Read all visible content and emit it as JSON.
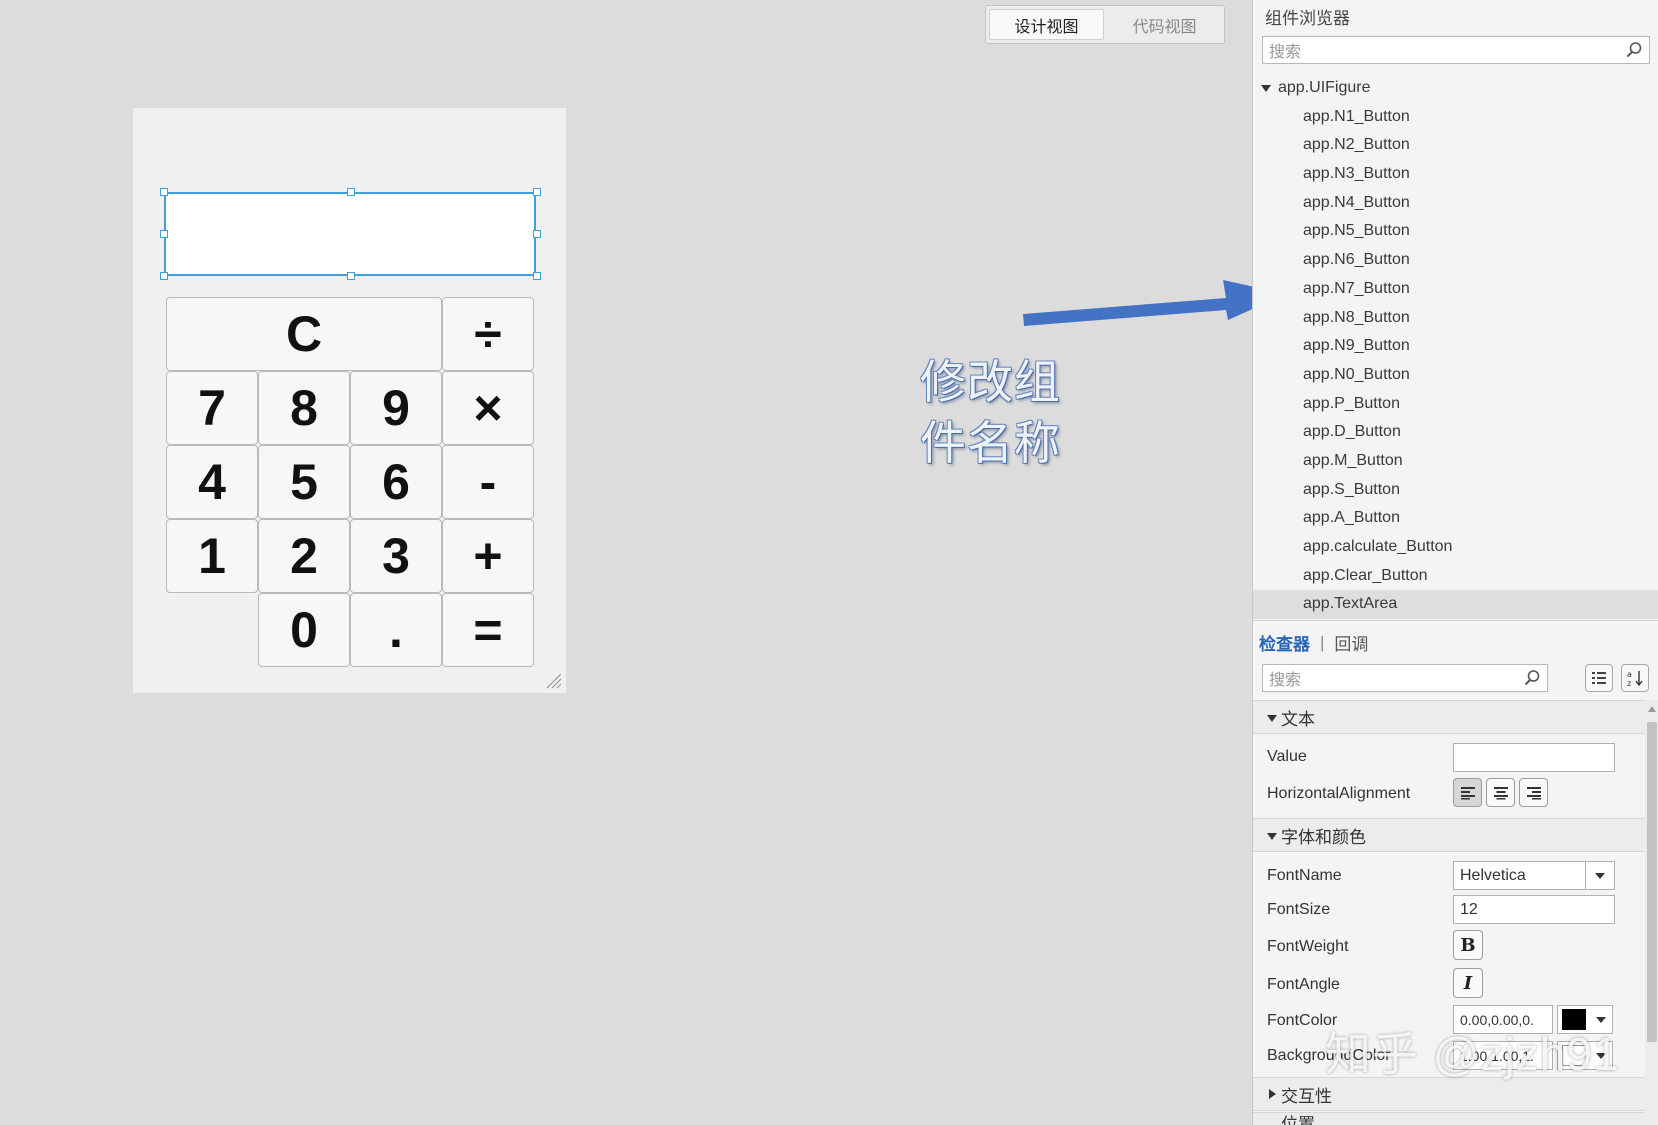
{
  "view_toggle": {
    "design": "设计视图",
    "code": "代码视图"
  },
  "calculator": {
    "buttons": [
      {
        "key": "clear",
        "label": "C"
      },
      {
        "key": "divide",
        "label": "÷"
      },
      {
        "key": "7",
        "label": "7"
      },
      {
        "key": "8",
        "label": "8"
      },
      {
        "key": "9",
        "label": "9"
      },
      {
        "key": "multiply",
        "label": "×"
      },
      {
        "key": "4",
        "label": "4"
      },
      {
        "key": "5",
        "label": "5"
      },
      {
        "key": "6",
        "label": "6"
      },
      {
        "key": "minus",
        "label": "-"
      },
      {
        "key": "1",
        "label": "1"
      },
      {
        "key": "2",
        "label": "2"
      },
      {
        "key": "3",
        "label": "3"
      },
      {
        "key": "plus",
        "label": "+"
      },
      {
        "key": "0",
        "label": "0"
      },
      {
        "key": "point",
        "label": "."
      },
      {
        "key": "equals",
        "label": "="
      }
    ]
  },
  "annotation": {
    "line1": "修改组",
    "line2": "件名称",
    "arrow_color": "#4472c4"
  },
  "component_browser": {
    "title": "组件浏览器",
    "search_placeholder": "搜索",
    "root": "app.UIFigure",
    "items": [
      "app.N1_Button",
      "app.N2_Button",
      "app.N3_Button",
      "app.N4_Button",
      "app.N5_Button",
      "app.N6_Button",
      "app.N7_Button",
      "app.N8_Button",
      "app.N9_Button",
      "app.N0_Button",
      "app.P_Button",
      "app.D_Button",
      "app.M_Button",
      "app.S_Button",
      "app.A_Button",
      "app.calculate_Button",
      "app.Clear_Button",
      "app.TextArea"
    ],
    "selected": "app.TextArea"
  },
  "inspector": {
    "tab_inspector": "检查器",
    "tab_separator": "|",
    "tab_callback": "回调",
    "search_placeholder": "搜索",
    "section_text": "文本",
    "section_font": "字体和颜色",
    "section_interactivity": "交互性",
    "section_position_partial": "位置",
    "props": {
      "value_label": "Value",
      "value": "",
      "halign_label": "HorizontalAlignment",
      "fontname_label": "FontName",
      "fontname": "Helvetica",
      "fontsize_label": "FontSize",
      "fontsize": "12",
      "fontweight_label": "FontWeight",
      "fontweight_glyph": "B",
      "fontangle_label": "FontAngle",
      "fontangle_glyph": "I",
      "fontcolor_label": "FontColor",
      "fontcolor": "0.00,0.00,0.",
      "fontcolor_swatch": "#000000",
      "bgcolor_label": "BackgroundColor",
      "bgcolor": "1.00,1.00,1."
    }
  },
  "watermark": "知乎 @zjzh91",
  "colors": {
    "accent": "#2a66b6",
    "selection": "#3ea0d8",
    "arrow": "#4472c4"
  }
}
